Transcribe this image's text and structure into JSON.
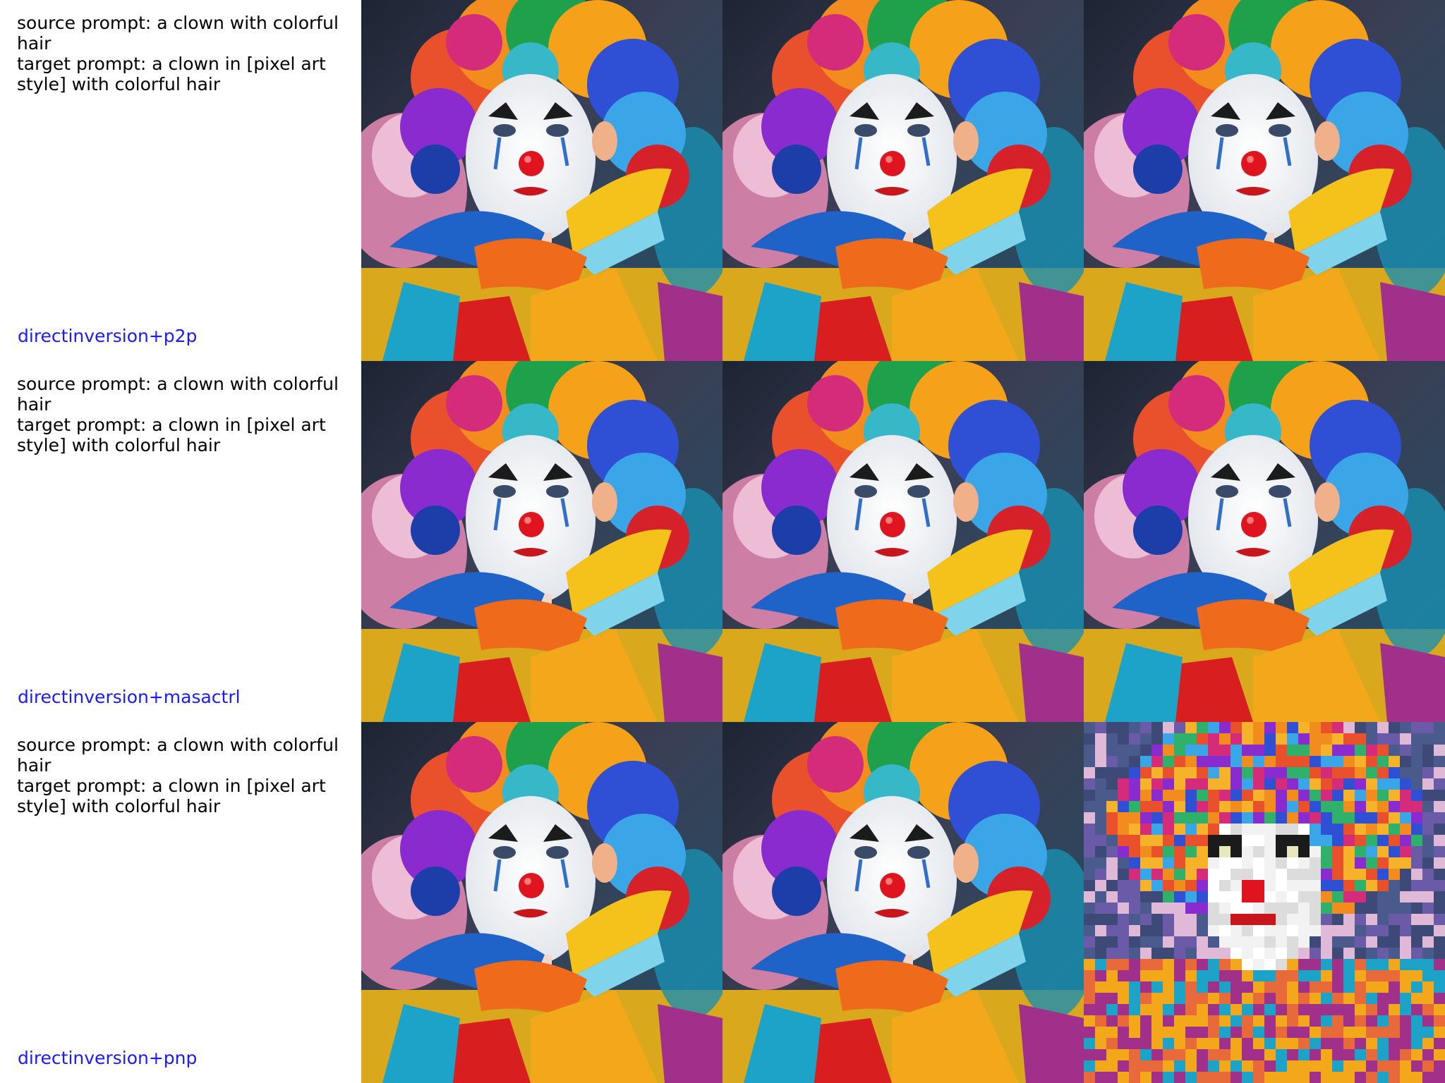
{
  "rows": [
    {
      "source_prompt": "source prompt: a clown with colorful hair",
      "target_prompt": "target prompt: a clown in [pixel art style] with colorful hair",
      "method": "directinversion+p2p",
      "images": [
        {
          "name": "clown-source-image",
          "style": "painting"
        },
        {
          "name": "clown-reconstruction-image",
          "style": "painting"
        },
        {
          "name": "clown-edited-image",
          "style": "painting"
        }
      ]
    },
    {
      "source_prompt": "source prompt: a clown with colorful hair",
      "target_prompt": "target prompt: a clown in [pixel art style] with colorful hair",
      "method": "directinversion+masactrl",
      "images": [
        {
          "name": "clown-source-image",
          "style": "painting"
        },
        {
          "name": "clown-reconstruction-image",
          "style": "painting"
        },
        {
          "name": "clown-edited-image",
          "style": "painting"
        }
      ]
    },
    {
      "source_prompt": "source prompt: a clown with colorful hair",
      "target_prompt": "target prompt: a clown in [pixel art style] with colorful hair",
      "method": "directinversion+pnp",
      "images": [
        {
          "name": "clown-source-image",
          "style": "painting"
        },
        {
          "name": "clown-reconstruction-image",
          "style": "painting"
        },
        {
          "name": "clown-edited-image",
          "style": "pixel"
        }
      ]
    }
  ],
  "colors": {
    "method_label": "#1a1aff",
    "prompt_text": "#000000"
  }
}
